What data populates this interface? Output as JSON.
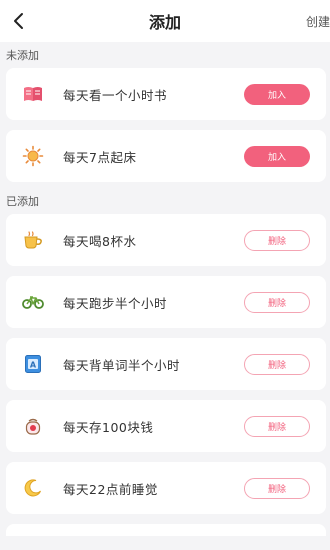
{
  "header": {
    "title": "添加",
    "action_label": "创建"
  },
  "sections": [
    {
      "title": "未添加",
      "items": [
        {
          "label": "每天看一个小时书",
          "icon": "book-icon",
          "button": "加入"
        },
        {
          "label": "每天7点起床",
          "icon": "sun-icon",
          "button": "加入"
        }
      ]
    },
    {
      "title": "已添加",
      "items": [
        {
          "label": "每天喝8杯水",
          "icon": "teacup-icon",
          "button": "删除"
        },
        {
          "label": "每天跑步半个小时",
          "icon": "bicycle-icon",
          "button": "删除"
        },
        {
          "label": "每天背单词半个小时",
          "icon": "word-card-icon",
          "button": "删除"
        },
        {
          "label": "每天存100块钱",
          "icon": "piggy-bank-icon",
          "button": "删除"
        },
        {
          "label": "每天22点前睡觉",
          "icon": "moon-icon",
          "button": "删除"
        }
      ]
    }
  ],
  "colors": {
    "accent": "#f2617d",
    "background": "#f4f4f6"
  }
}
